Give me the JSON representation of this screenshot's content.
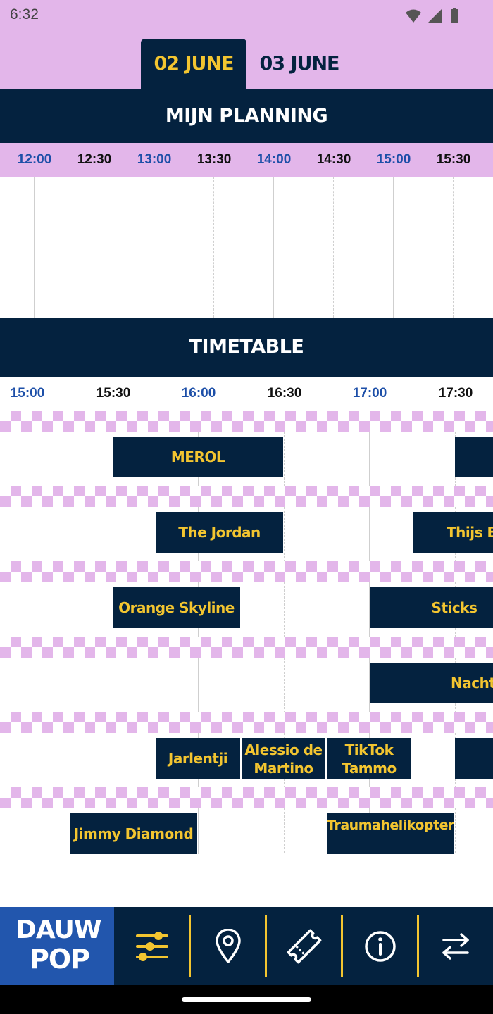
{
  "status_bar": {
    "time": "6:32"
  },
  "date_tabs": [
    {
      "label": "02 JUNE",
      "active": true
    },
    {
      "label": "03 JUNE",
      "active": false
    }
  ],
  "planning": {
    "title": "MIJN PLANNING",
    "times": [
      "12:00",
      "12:30",
      "13:00",
      "13:30",
      "14:00",
      "14:30",
      "15:00",
      "15:30"
    ]
  },
  "timetable": {
    "title": "TIMETABLE",
    "times": [
      "15:00",
      "15:30",
      "16:00",
      "16:30",
      "17:00",
      "17:30"
    ],
    "rows": [
      {
        "acts": [
          {
            "name": "MEROL",
            "start": "15:30",
            "end": "16:30"
          },
          {
            "name": "",
            "start": "17:30",
            "end": "18:00"
          }
        ]
      },
      {
        "acts": [
          {
            "name": "The Jordan",
            "start": "15:45",
            "end": "16:30"
          },
          {
            "name": "Thijs B",
            "start": "17:15",
            "end": "18:00"
          }
        ]
      },
      {
        "acts": [
          {
            "name": "Orange Skyline",
            "start": "15:30",
            "end": "16:15"
          },
          {
            "name": "Sticks",
            "start": "17:00",
            "end": "18:00"
          }
        ]
      },
      {
        "acts": [
          {
            "name": "Nachtb",
            "start": "17:00",
            "end": "18:00"
          }
        ]
      },
      {
        "acts": [
          {
            "name": "Jarlentji",
            "start": "15:45",
            "end": "16:15"
          },
          {
            "name": "Alessio de Martino",
            "start": "16:15",
            "end": "16:45"
          },
          {
            "name": "TikTok Tammo",
            "start": "16:45",
            "end": "17:15"
          },
          {
            "name": "",
            "start": "17:30",
            "end": "18:00"
          }
        ]
      },
      {
        "acts": [
          {
            "name": "Jimmy Diamond",
            "start": "15:15",
            "end": "16:00"
          },
          {
            "name": "Traumahelikopter",
            "start": "16:45",
            "end": "17:30"
          }
        ]
      }
    ]
  },
  "bottom_nav": {
    "logo_line1": "DAUW",
    "logo_line2": "POP",
    "items": [
      "filter-icon",
      "location-pin-icon",
      "ticket-icon",
      "info-icon",
      "swap-arrows-icon"
    ]
  },
  "colors": {
    "navy": "#04223f",
    "lilac": "#e3b6ea",
    "yellow": "#f3c530",
    "blue": "#2256ad",
    "hour_blue": "#1d4fa8"
  }
}
